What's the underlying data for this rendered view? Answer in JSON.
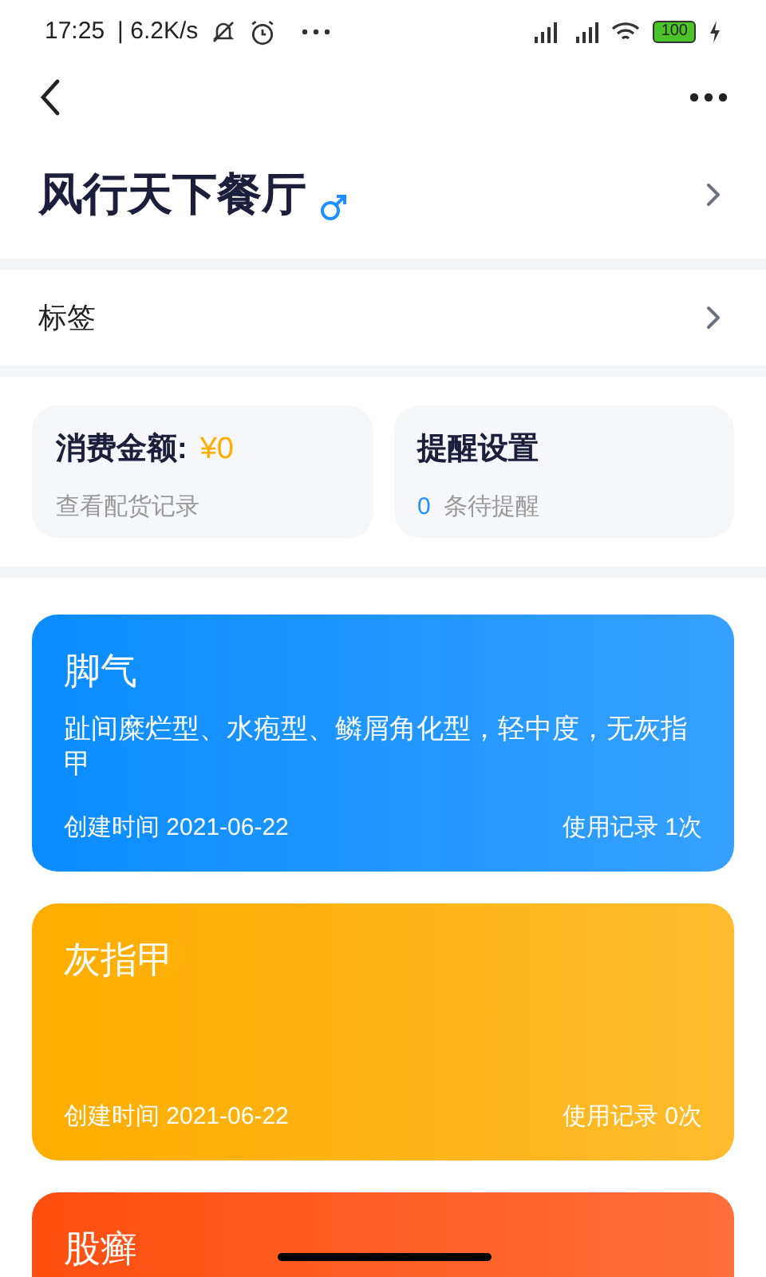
{
  "status_bar": {
    "time": "17:25",
    "speed": "| 6.2K/s",
    "battery": "100"
  },
  "header": {
    "title": "风行天下餐厅"
  },
  "tags_row": {
    "label": "标签"
  },
  "stats": [
    {
      "label": "消费金额:",
      "value": "¥0",
      "sub": "查看配货记录"
    },
    {
      "label": "提醒设置",
      "count": "0",
      "sub": "条待提醒"
    }
  ],
  "records": [
    {
      "title": "脚气",
      "description": "趾间糜烂型、水疱型、鳞屑角化型，轻中度，无灰指甲",
      "created": "创建时间 2021-06-22",
      "usage": "使用记录 1次",
      "color": "#0a8cff"
    },
    {
      "title": "灰指甲",
      "created": "创建时间 2021-06-22",
      "usage": "使用记录 0次",
      "color": "#ffad00"
    },
    {
      "title": "股癣",
      "color": "#ff4f10"
    }
  ]
}
